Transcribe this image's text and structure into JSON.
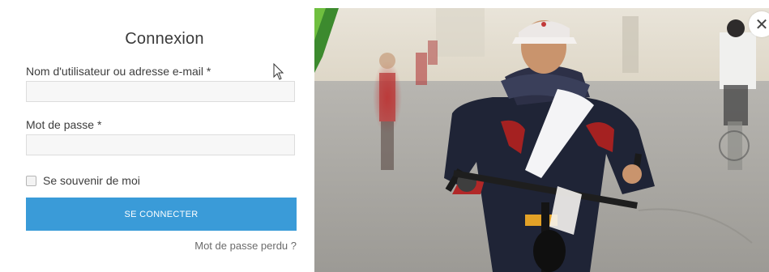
{
  "login": {
    "title": "Connexion",
    "username_label": "Nom d'utilisateur ou adresse e-mail *",
    "username_value": "",
    "password_label": "Mot de passe *",
    "password_value": "",
    "remember_label": "Se souvenir de moi",
    "remember_checked": false,
    "submit_label": "SE CONNECTER",
    "lost_password_label": "Mot de passe perdu ?"
  },
  "close_icon": "close-icon",
  "colors": {
    "accent": "#3a9bd8",
    "input_bg": "#f7f7f7",
    "input_border": "#dddddd"
  },
  "image": {
    "subject": "girl-riding-bicycle-photo"
  }
}
